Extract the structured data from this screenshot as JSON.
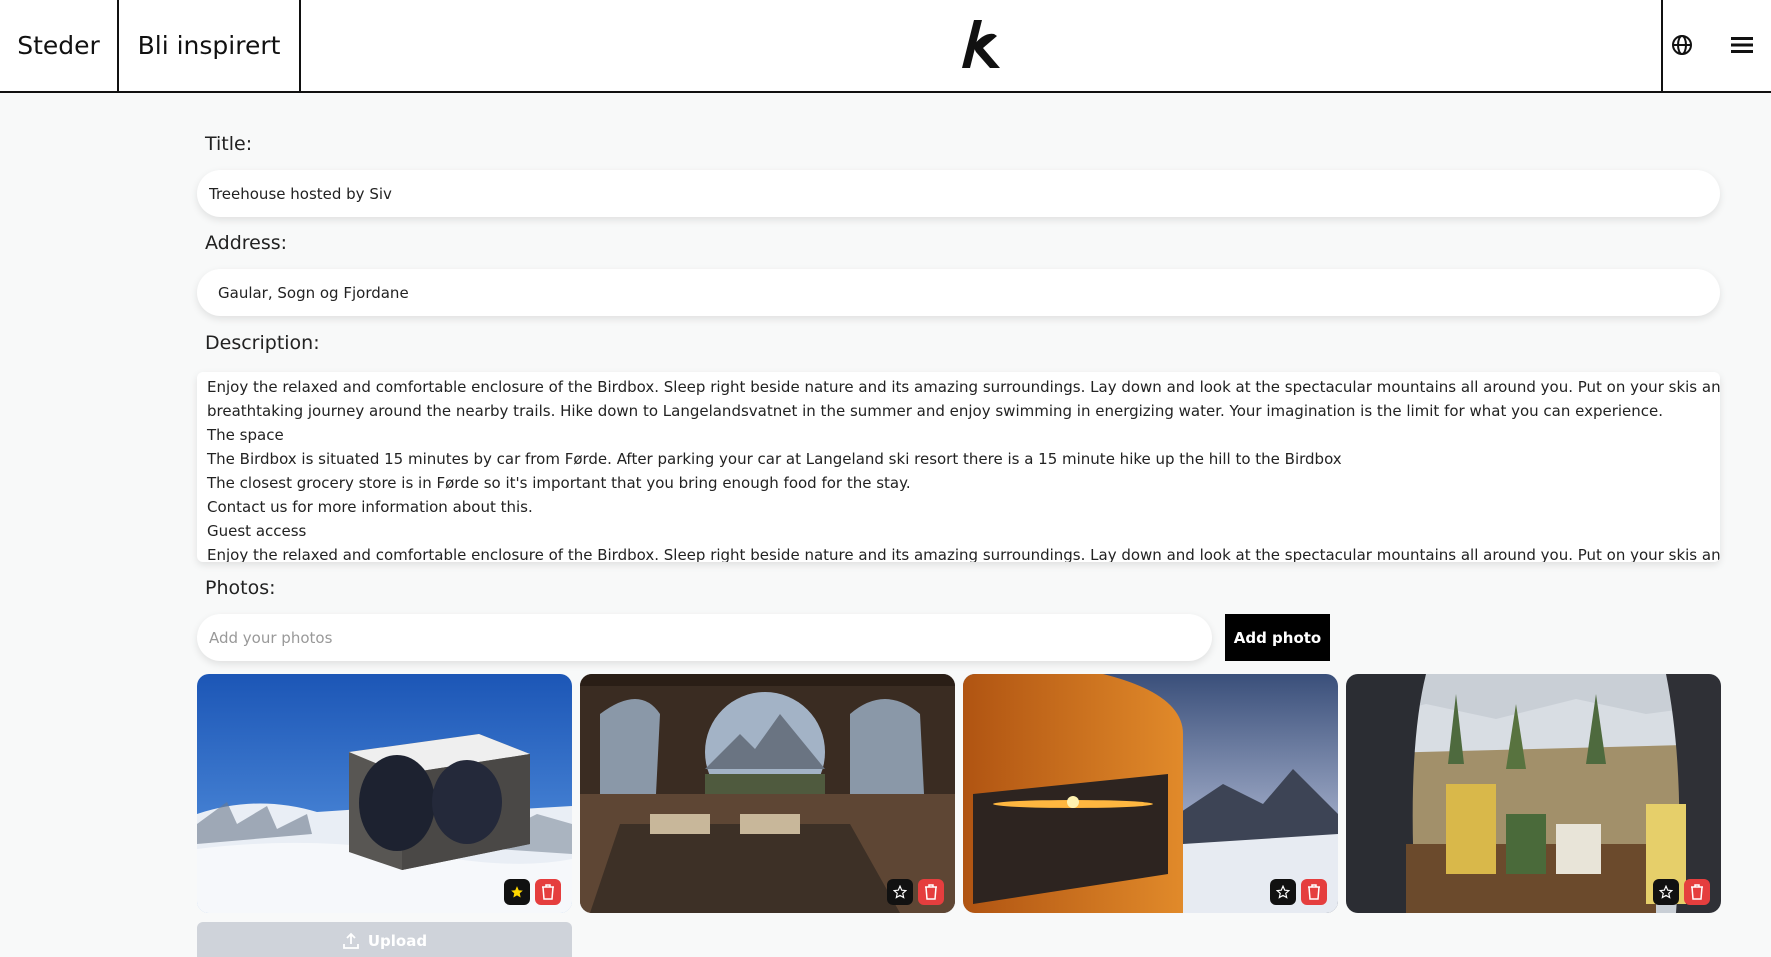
{
  "header": {
    "tabs": [
      {
        "label": "Steder"
      },
      {
        "label": "Bli inspirert"
      }
    ],
    "logo_text": "k",
    "icons": [
      "globe-icon",
      "menu-icon"
    ]
  },
  "form": {
    "title_label": "Title:",
    "title_value": "Treehouse hosted by Siv",
    "address_label": "Address:",
    "address_value": "Gaular, Sogn og Fjordane",
    "description_label": "Description:",
    "description_lines": [
      "Enjoy the relaxed and comfortable enclosure of the Birdbox. Sleep right beside nature and its amazing surroundings. Lay down and look at the spectacular mountains all around you. Put on your skis and have a",
      "breathtaking journey around the nearby trails. Hike down to Langelandsvatnet in the summer and enjoy swimming in energizing water. Your imagination is the limit for what you can experience.",
      "The space",
      "The Birdbox is situated 15 minutes by car from Førde. After parking your car at Langeland ski resort there is a 15 minute hike up the hill to the Birdbox",
      "The closest grocery store is in Førde so it's important that you bring enough food for the stay.",
      "Contact us for more information about this.",
      "Guest access",
      "Enjoy the relaxed and comfortable enclosure of the Birdbox. Sleep right beside nature and its amazing surroundings. Lay down and look at the spectacular mountains all around you. Put on your skis and have a"
    ],
    "photos_label": "Photos:",
    "photos_placeholder": "Add your photos",
    "add_photo_label": "Add photo",
    "upload_label": "Upload"
  },
  "photos": [
    {
      "name": "snowy-birdbox-photo",
      "starred": true
    },
    {
      "name": "birdbox-interior-bed-photo",
      "starred": false
    },
    {
      "name": "sunset-reflection-photo",
      "starred": false
    },
    {
      "name": "interior-table-view-photo",
      "starred": false
    }
  ],
  "colors": {
    "accent": "#000000",
    "delete": "#e53e3e",
    "star_active": "#ffd700",
    "upload_disabled": "#cfd3da"
  }
}
